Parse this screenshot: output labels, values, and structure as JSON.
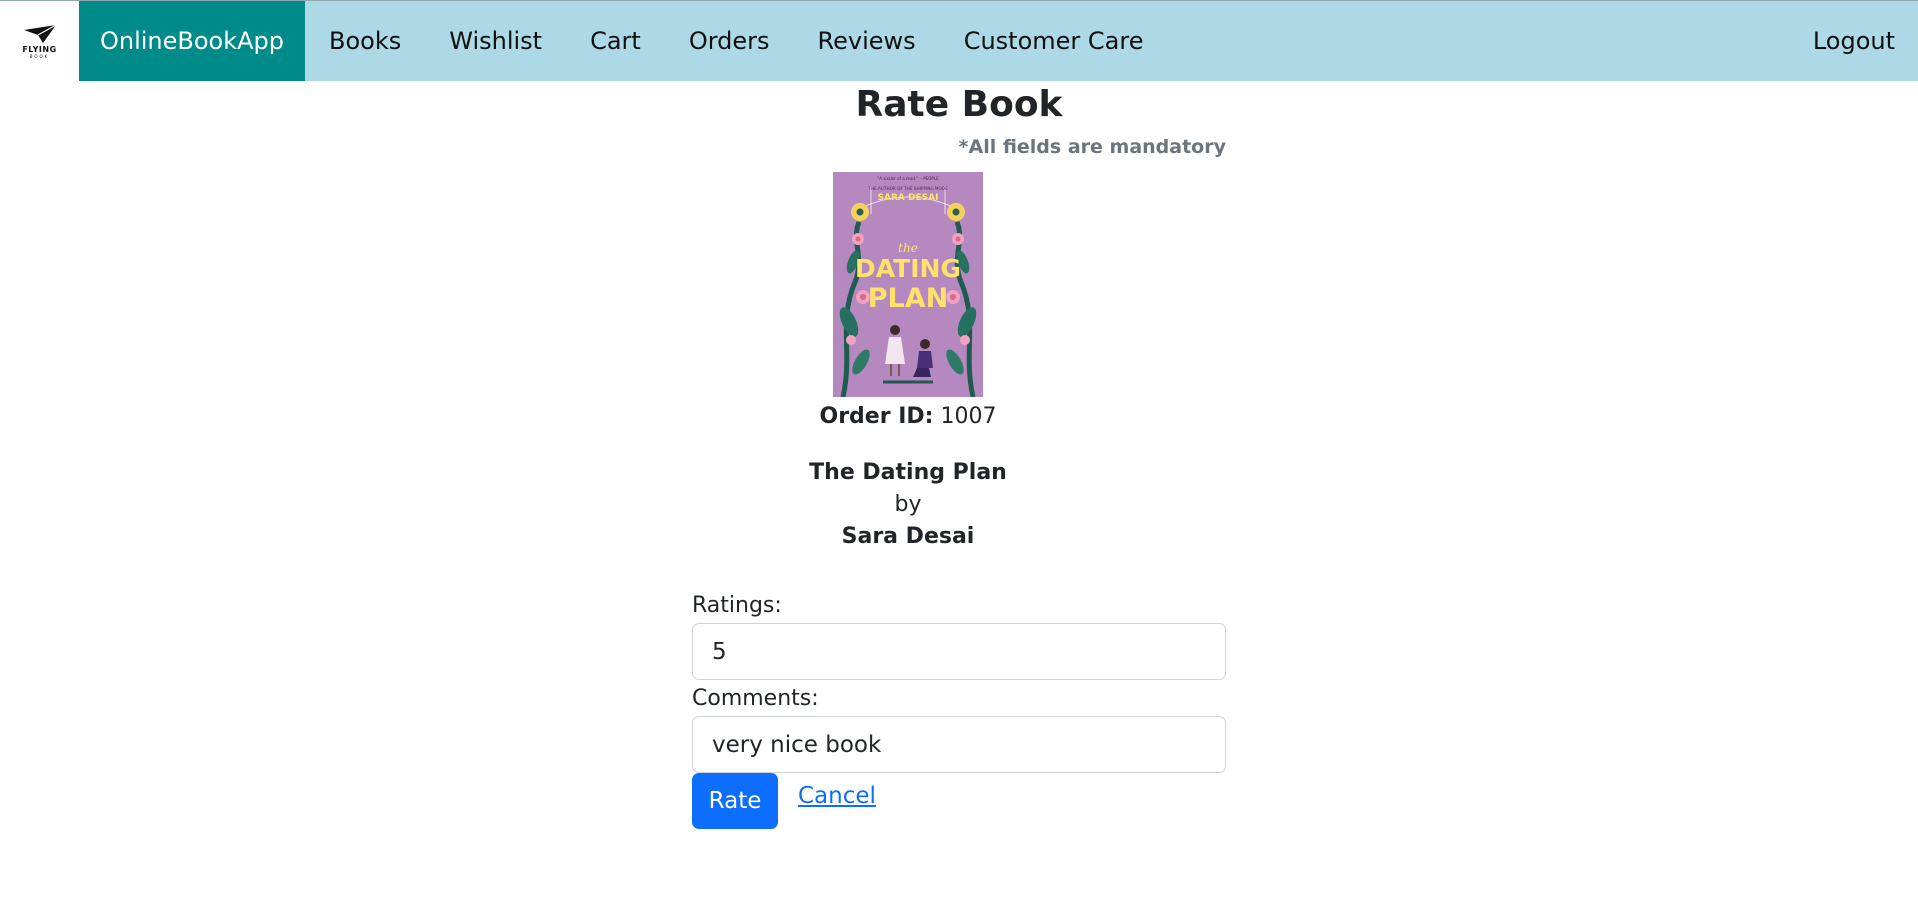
{
  "nav": {
    "logo_text": "FLYING",
    "logo_subtext": "BOOK",
    "brand": "OnlineBookApp",
    "items": [
      {
        "label": "Books"
      },
      {
        "label": "Wishlist"
      },
      {
        "label": "Cart"
      },
      {
        "label": "Orders"
      },
      {
        "label": "Reviews"
      },
      {
        "label": "Customer Care"
      }
    ],
    "logout": "Logout"
  },
  "page": {
    "title": "Rate Book",
    "mandatory_note": "*All fields are mandatory"
  },
  "book": {
    "cover_icon": "book-cover-image",
    "cover_top_quote": "\"A sizzler of a read.\" —PEOPLE",
    "cover_tagline": "THE AUTHOR OF THE SHIPPING MODE",
    "cover_author": "SARA DESAI",
    "cover_title_line1": "the",
    "cover_title_line2": "DATING",
    "cover_title_line3": "PLAN",
    "order_id_label": "Order ID:",
    "order_id": "1007",
    "title": "The Dating Plan",
    "by": "by",
    "author": "Sara Desai"
  },
  "form": {
    "ratings_label": "Ratings:",
    "ratings_value": "5",
    "comments_label": "Comments:",
    "comments_value": "very nice book",
    "rate_button": "Rate",
    "cancel_link": "Cancel"
  },
  "colors": {
    "navbar": "#add8e6",
    "brand": "#008b8b",
    "primary": "#0d6efd",
    "muted": "#6c757d",
    "cover": "#b589c0"
  }
}
